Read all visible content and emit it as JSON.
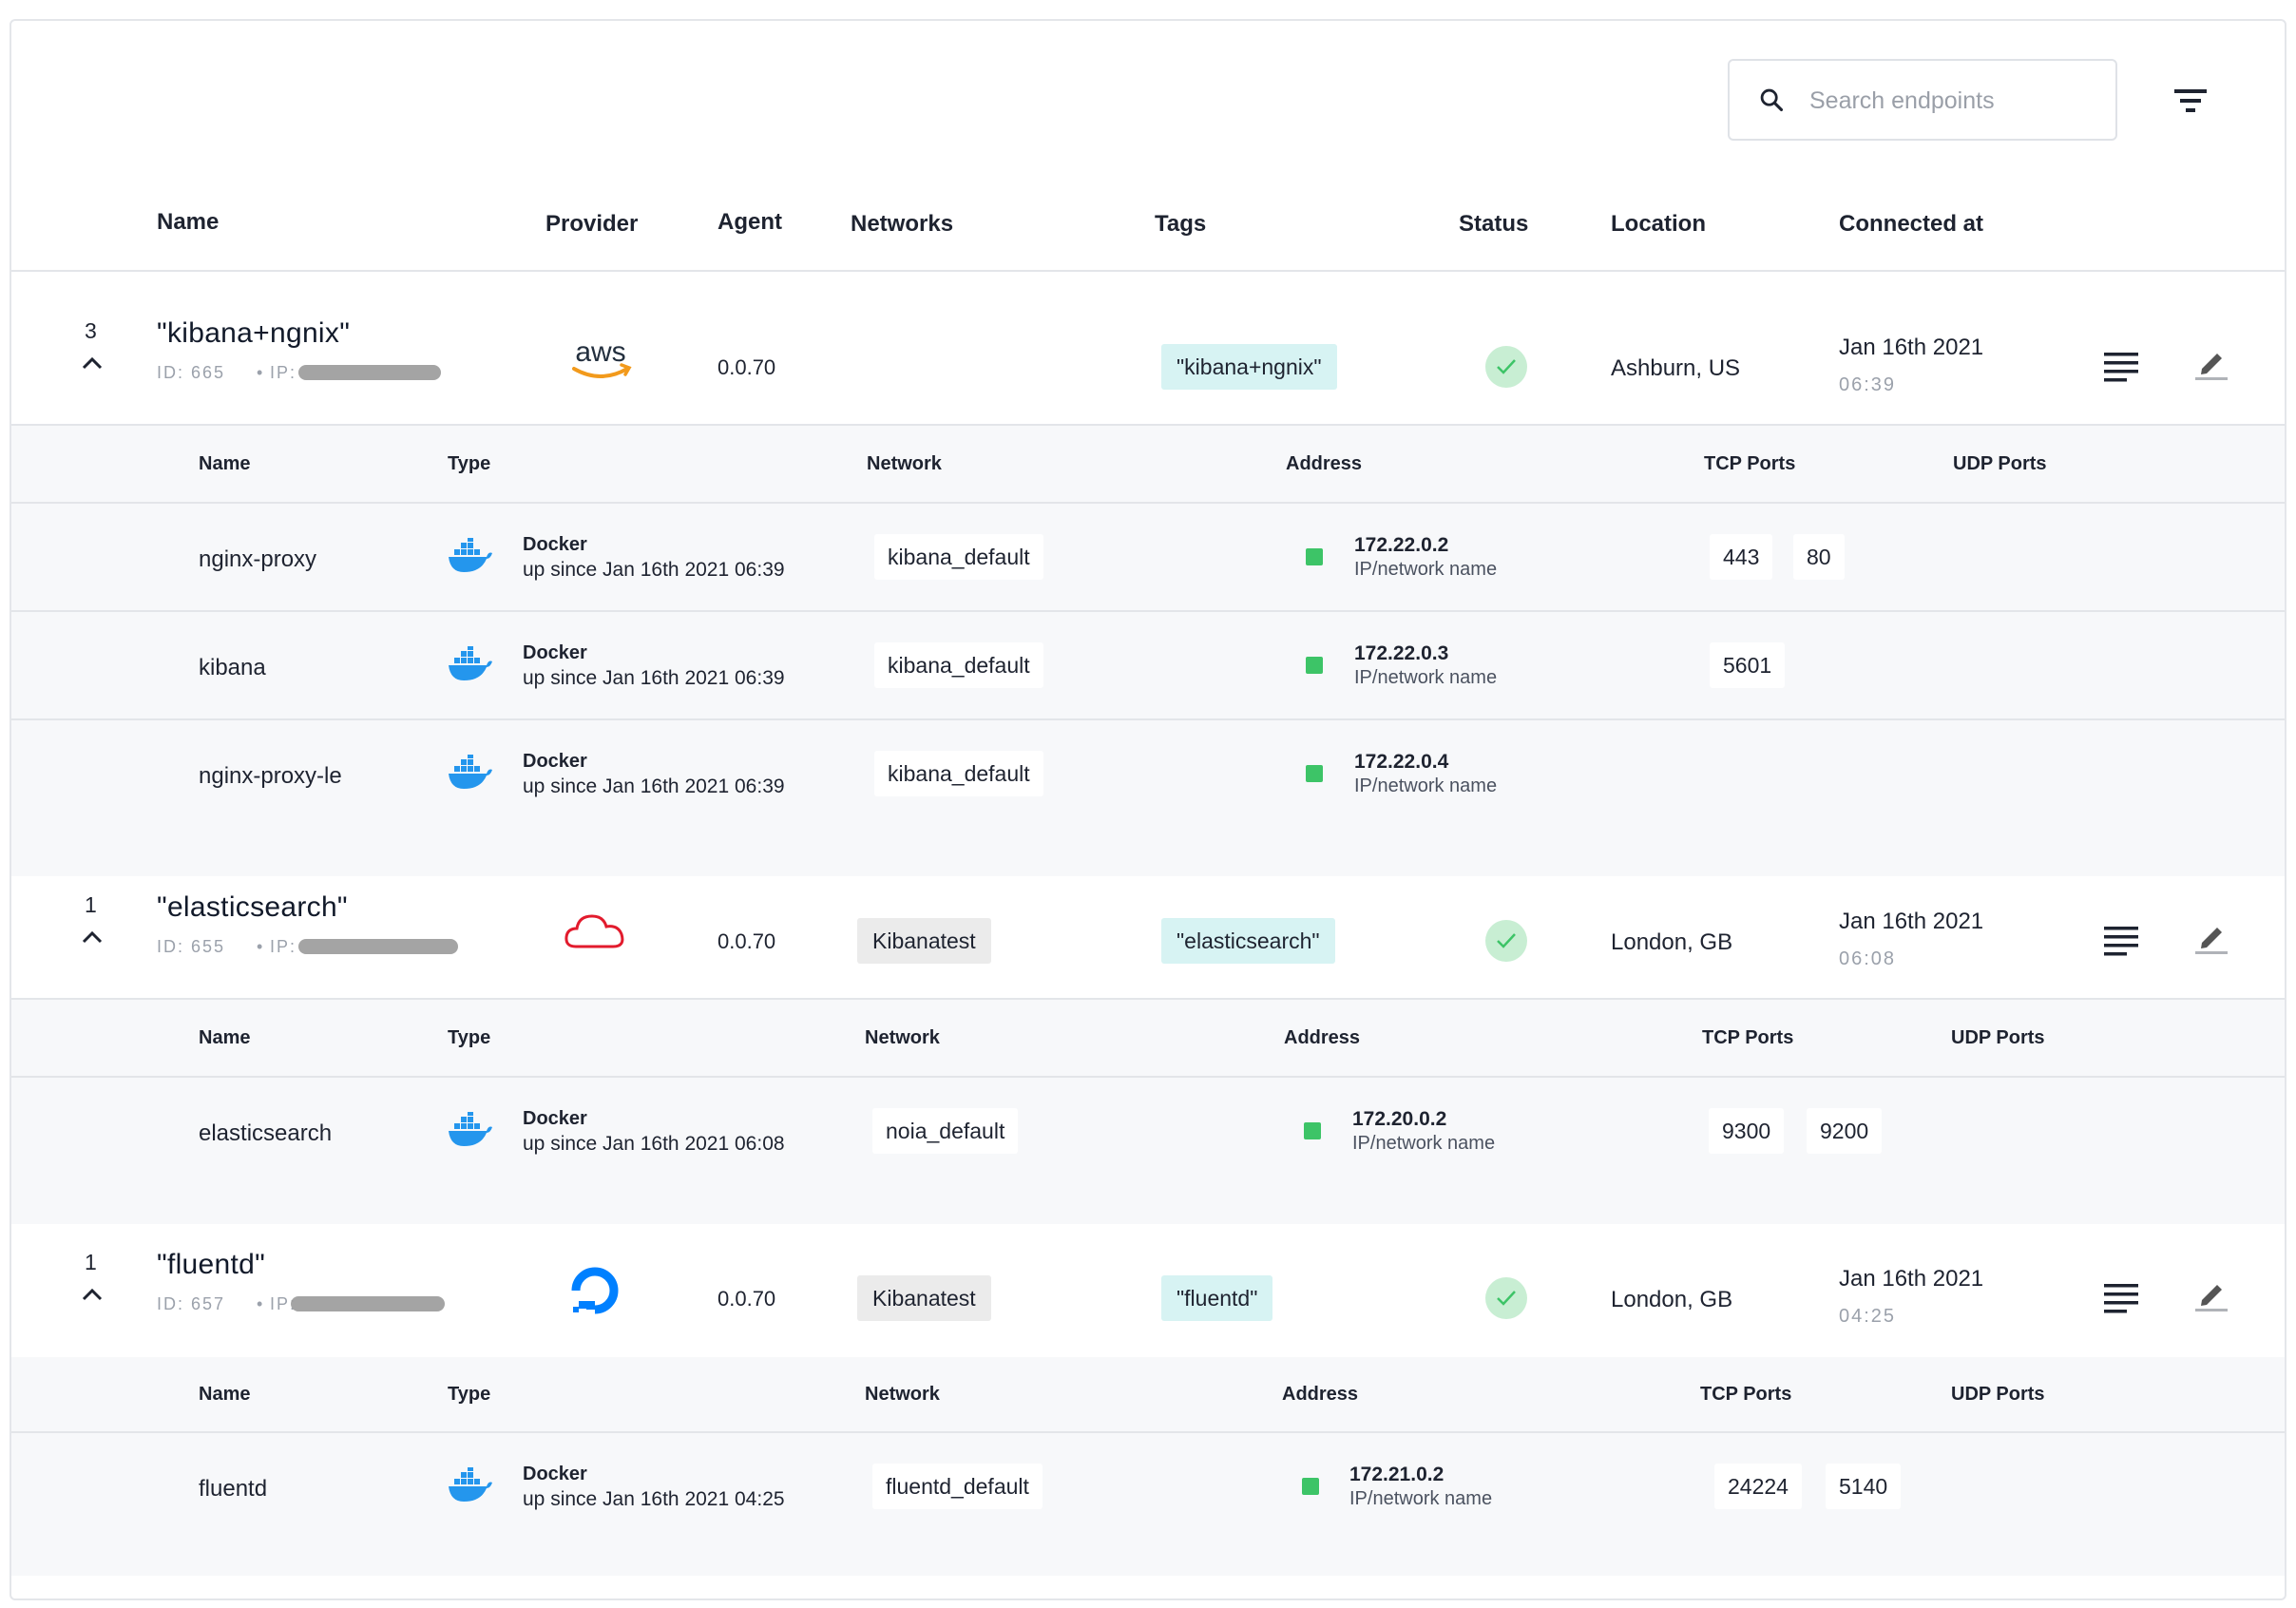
{
  "search": {
    "placeholder": "Search endpoints"
  },
  "columns": {
    "name": "Name",
    "provider": "Provider",
    "agent": "Agent",
    "networks": "Networks",
    "tags": "Tags",
    "status": "Status",
    "location": "Location",
    "connected_at": "Connected at"
  },
  "sub_columns": {
    "name": "Name",
    "type": "Type",
    "network": "Network",
    "address": "Address",
    "tcp": "TCP Ports",
    "udp": "UDP Ports"
  },
  "colors": {
    "tag_bg": "#d7f3f3",
    "status_ok": "#3dc467",
    "border": "#e3e5e9",
    "band": "#f7f8fa"
  },
  "endpoints": [
    {
      "count": "3",
      "name": "\"kibana+ngnix\"",
      "id_label": "ID: 665",
      "ip_label": "IP:",
      "provider": "aws",
      "provider_icon": "aws-logo-icon",
      "agent": "0.0.70",
      "network": "",
      "tag": "\"kibana+ngnix\"",
      "status": "ok",
      "location": "Ashburn, US",
      "connected_date": "Jan 16th 2021",
      "connected_time": "06:39",
      "containers": [
        {
          "name": "nginx-proxy",
          "type": "Docker",
          "since": "up since Jan 16th 2021 06:39",
          "network": "kibana_default",
          "address": "172.22.0.2",
          "address_sub": "IP/network name",
          "tcp": [
            "443",
            "80"
          ]
        },
        {
          "name": "kibana",
          "type": "Docker",
          "since": "up since Jan 16th 2021 06:39",
          "network": "kibana_default",
          "address": "172.22.0.3",
          "address_sub": "IP/network name",
          "tcp": [
            "5601"
          ]
        },
        {
          "name": "nginx-proxy-le",
          "type": "Docker",
          "since": "up since Jan 16th 2021 06:39",
          "network": "kibana_default",
          "address": "172.22.0.4",
          "address_sub": "IP/network name",
          "tcp": []
        }
      ]
    },
    {
      "count": "1",
      "name": "\"elasticsearch\"",
      "id_label": "ID: 655",
      "ip_label": "IP:",
      "provider": "cloud",
      "provider_icon": "cloud-icon",
      "agent": "0.0.70",
      "network": "Kibanatest",
      "tag": "\"elasticsearch\"",
      "status": "ok",
      "location": "London, GB",
      "connected_date": "Jan 16th 2021",
      "connected_time": "06:08",
      "containers": [
        {
          "name": "elasticsearch",
          "type": "Docker",
          "since": "up since Jan 16th 2021 06:08",
          "network": "noia_default",
          "address": "172.20.0.2",
          "address_sub": "IP/network name",
          "tcp": [
            "9300",
            "9200"
          ]
        }
      ]
    },
    {
      "count": "1",
      "name": "\"fluentd\"",
      "id_label": "ID: 657",
      "ip_label": "IP:",
      "provider": "digitalocean",
      "provider_icon": "digitalocean-logo-icon",
      "agent": "0.0.70",
      "network": "Kibanatest",
      "tag": "\"fluentd\"",
      "status": "ok",
      "location": "London, GB",
      "connected_date": "Jan 16th 2021",
      "connected_time": "04:25",
      "containers": [
        {
          "name": "fluentd",
          "type": "Docker",
          "since": "up since Jan 16th 2021 04:25",
          "network": "fluentd_default",
          "address": "172.21.0.2",
          "address_sub": "IP/network name",
          "tcp": [
            "24224",
            "5140"
          ]
        }
      ]
    }
  ]
}
